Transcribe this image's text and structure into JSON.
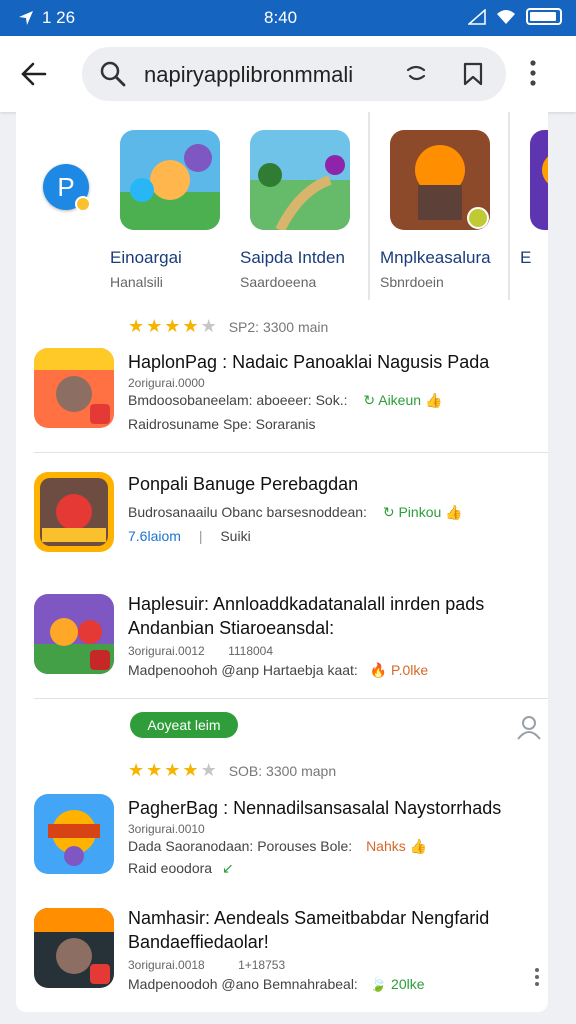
{
  "status_bar": {
    "left_text": "1 26",
    "time": "8:40"
  },
  "search": {
    "query": "napiryapplibronmmali"
  },
  "featured": [
    {
      "name": "Einoargai",
      "sub": "Hanalsili"
    },
    {
      "name": "Saipda Intden",
      "sub": "Saardoeena"
    },
    {
      "name": "Mnplkeasalura",
      "sub": "Sbnrdoein"
    },
    {
      "name": "E",
      "sub": ""
    }
  ],
  "rating_top": {
    "stars": 4,
    "text": "SP2:  3300  main"
  },
  "apps": [
    {
      "title": "HaplonPag : Nadaic Panoaklai Nagusis Pada",
      "line1": "2origurai.0000",
      "line2": "Bmdoosobaneelam: aboeeer: Sok.:",
      "line2_tag": "Aikeun",
      "line3": "Raidrosuname Spe: Soraranis",
      "icon_label": "VANEE"
    },
    {
      "title": "Ponpali Banuge Perebagdan",
      "line1": "Budrosanaailu Obanc barsesnoddean:",
      "line1_tag": "Pinkou",
      "line2": "7.6laiom",
      "line2b": "Suiki",
      "icon_label": "SOANGL"
    },
    {
      "title": "Haplesuir: Annloaddkadatanalall inrden pads",
      "title2": "Andanbian Stiaroeansdal:",
      "line1": "3origurai.0012",
      "line1b": "1118004",
      "line2": "Madpenoohoh @anp Hartaebja kaat:",
      "line2_tag": "P.0lke",
      "icon_label": "RANDK"
    }
  ],
  "pill_label": "Aoyeat leim",
  "rating_mid": {
    "stars": 4,
    "text": "SOB:  3300  mapn"
  },
  "apps2": [
    {
      "title": "PagherBag : Nennadilsansasalal Naystorrhads",
      "line1": "3origurai.0010",
      "line2": "Dada Saoranodaan: Porouses Bole:",
      "line2_tag": "Nahks",
      "line3": "Raid eoodora",
      "icon_label": "BANMUR"
    },
    {
      "title": "Namhasir: Aendeals Sameitbabdar Nengfarid",
      "title2": "Bandaeffiedaolar!",
      "line1": "3origurai.0018",
      "line1b": "1+18753",
      "line2": "Madpenoodoh @ano Bemnahrabeal:",
      "line2_tag": "20lke",
      "icon_label": "NENKUN"
    }
  ],
  "colors": {
    "accent": "#1565c0",
    "green": "#2e9d3a",
    "star": "#f4b400"
  }
}
